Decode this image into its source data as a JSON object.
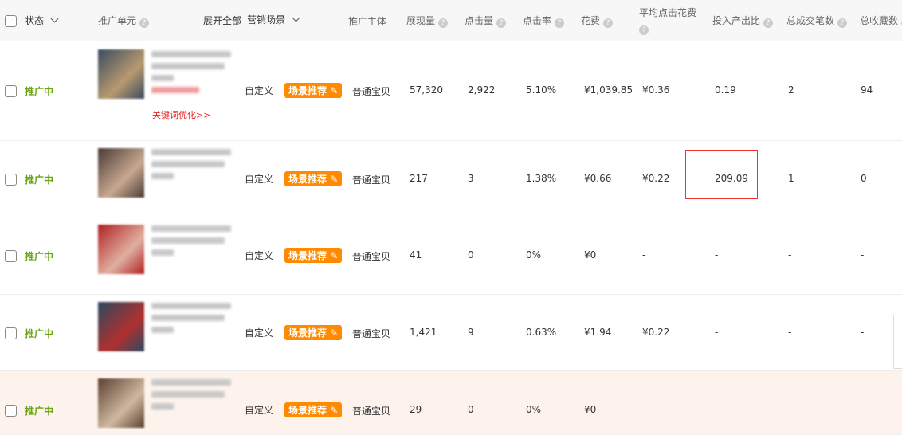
{
  "header": {
    "status": "状态",
    "unit": "推广单元",
    "expand_all": "展开全部",
    "scene": "营销场景",
    "subject": "推广主体",
    "impressions": "展现量",
    "clicks": "点击量",
    "ctr": "点击率",
    "cost": "花费",
    "avg_cpc": "平均点击花费",
    "roi": "投入产出比",
    "orders": "总成交笔数",
    "favorites": "总收藏数",
    "help_icon": "?"
  },
  "rows": [
    {
      "status": "推广中",
      "scene": "自定义",
      "badge": "场景推荐",
      "subject": "普通宝贝",
      "impressions": "57,320",
      "clicks": "2,922",
      "ctr": "5.10%",
      "cost": "¥1,039.85",
      "avg_cpc": "¥0.36",
      "roi": "0.19",
      "orders": "2",
      "favorites": "94",
      "link": "关键词优化>>",
      "thumb": [
        "#3a4a60",
        "#b89a70"
      ]
    },
    {
      "status": "推广中",
      "scene": "自定义",
      "badge": "场景推荐",
      "subject": "普通宝贝",
      "impressions": "217",
      "clicks": "3",
      "ctr": "1.38%",
      "cost": "¥0.66",
      "avg_cpc": "¥0.22",
      "roi": "209.09",
      "orders": "1",
      "favorites": "0",
      "thumb": [
        "#4a3a34",
        "#c8a890"
      ]
    },
    {
      "status": "推广中",
      "scene": "自定义",
      "badge": "场景推荐",
      "subject": "普通宝贝",
      "impressions": "41",
      "clicks": "0",
      "ctr": "0%",
      "cost": "¥0",
      "avg_cpc": "-",
      "roi": "-",
      "orders": "-",
      "favorites": "-",
      "thumb": [
        "#b02020",
        "#e0b0a0"
      ]
    },
    {
      "status": "推广中",
      "scene": "自定义",
      "badge": "场景推荐",
      "subject": "普通宝贝",
      "impressions": "1,421",
      "clicks": "9",
      "ctr": "0.63%",
      "cost": "¥1.94",
      "avg_cpc": "¥0.22",
      "roi": "-",
      "orders": "-",
      "favorites": "-",
      "thumb": [
        "#2a4a60",
        "#b03030"
      ]
    },
    {
      "status": "推广中",
      "scene": "自定义",
      "badge": "场景推荐",
      "subject": "普通宝贝",
      "impressions": "29",
      "clicks": "0",
      "ctr": "0%",
      "cost": "¥0",
      "avg_cpc": "-",
      "roi": "-",
      "orders": "-",
      "favorites": "-",
      "thumb": [
        "#5a4030",
        "#d0b8a0"
      ]
    }
  ]
}
